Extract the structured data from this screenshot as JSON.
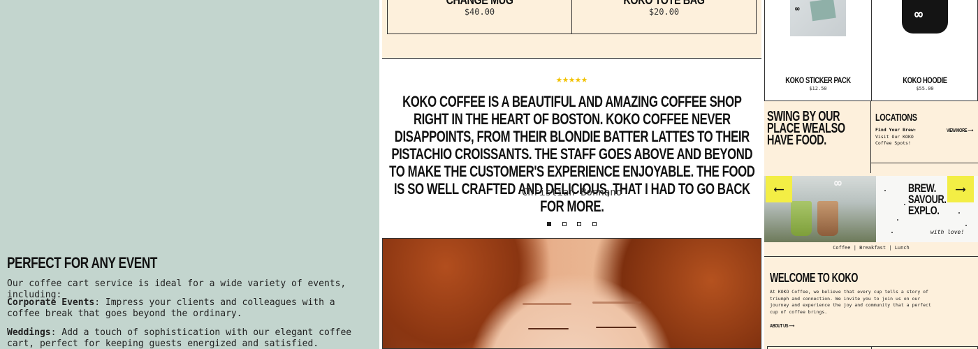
{
  "left": {
    "title": "PERFECT FOR ANY EVENT",
    "intro": "Our coffee cart service is ideal for a wide variety of events, including:",
    "items": [
      {
        "label": "Corporate Events",
        "text": ": Impress your clients and colleagues with a coffee break that goes beyond the ordinary."
      },
      {
        "label": "Weddings",
        "text": ": Add a touch of sophistication with our elegant coffee cart, perfect for keeping guests energized and satisfied."
      }
    ]
  },
  "middle": {
    "products": [
      {
        "name": "CHANGE MUG",
        "price": "$40.00"
      },
      {
        "name": "KOKO TOTE BAG",
        "price": "$20.00"
      }
    ],
    "testimonial": {
      "stars": "★★★★★",
      "rating": 5,
      "quote": "KOKO COFFEE IS A BEAUTIFUL AND AMAZING COFFEE SHOP RIGHT IN THE HEART OF BOSTON. KOKO COFFEE NEVER DISAPPOINTS, FROM THEIR BLONDIE BATTER LATTES TO THEIR PISTACHIO CROISSANTS. THE STAFF GOES ABOVE AND BEYOND TO MAKE THE CUSTOMER'S EXPERIENCE ENJOYABLE. THE FOOD IS SO WELL CRAFTED AND DELICIOUS, THAT I HAD TO GO BACK FOR MORE.",
      "author": "Christian Bonnano",
      "slides": 4,
      "active_slide": 1
    }
  },
  "right": {
    "shop_items": [
      {
        "name": "KOKO STICKER PACK",
        "price": "$12.50",
        "image": "sticker-pack-photo"
      },
      {
        "name": "KOKO HOODIE",
        "price": "$55.00",
        "image": "hoodie-photo"
      }
    ],
    "swing_text": "SWING BY OUR PLACE WEALSO HAVE FOOD.",
    "locations": {
      "title": "LOCATIONS",
      "find_label": "Find Your Brew:",
      "find_text": "Visit Our KOKO Coffee Spots!",
      "more": "VIEW MORE ⟶"
    },
    "gallery": {
      "prev_arrow": "⟵",
      "next_arrow": "⟶",
      "brew_text": "BREW. SAVOUR. EXPLO.",
      "love": "with love!",
      "sign_logo": "∞"
    },
    "categories": "Coffee | Breakfast | Lunch",
    "welcome": {
      "title": "WELCOME TO KOKO",
      "text": "At KOKO Coffee, we believe that every cup tells a story of triumph and connection. We invite you to join us on our journey and experience the joy and community that a perfect cup of coffee brings.",
      "about": "ABOUT US ⟶"
    }
  },
  "colors": {
    "left_bg": "#c3d5ce",
    "cream": "#fdf0dc",
    "star": "#f2c200",
    "arrow_yellow": "#f3ee45"
  }
}
